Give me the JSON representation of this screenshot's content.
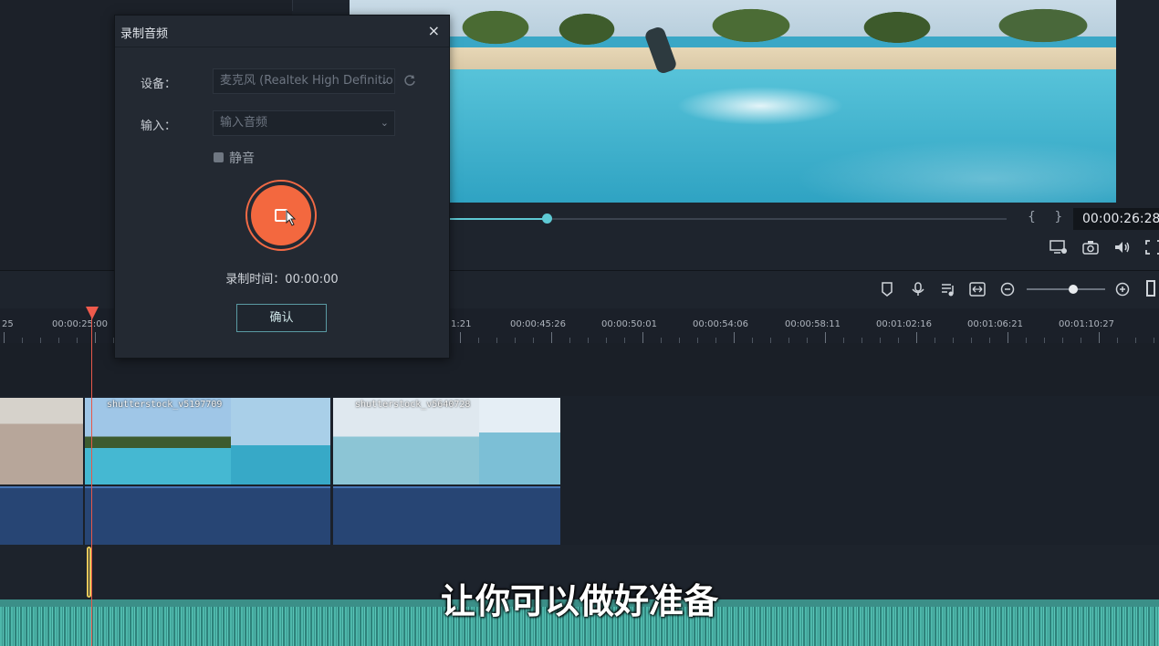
{
  "dialog": {
    "title": "录制音频",
    "close": "×",
    "device_label": "设备：",
    "device_value": "麦克风 (Realtek High Definition",
    "input_label": "输入：",
    "input_placeholder": "输入音频",
    "mute_label": "静音",
    "record_time_label": "录制时间：00:00:00",
    "confirm_button": "确认"
  },
  "preview": {
    "timecode": "00:00:26:28",
    "brackets": "{ }",
    "progress": 0.3
  },
  "ruler": {
    "labels": [
      "25",
      "00:00:25:00",
      "1:21",
      "00:00:45:26",
      "00:00:50:01",
      "00:00:54:06",
      "00:00:58:11",
      "00:01:02:16",
      "00:01:06:21",
      "00:01:10:27"
    ]
  },
  "clips": [
    {
      "name": ""
    },
    {
      "name": "shutterstock_v5197709"
    },
    {
      "name": "shutterstock_v5640728"
    }
  ],
  "subtitle": "让你可以做好准备",
  "icons": {
    "preview_tools": [
      "render-preview-icon",
      "snapshot-icon",
      "volume-icon",
      "fullscreen-icon"
    ],
    "toolbar": [
      "marker-icon",
      "microphone-icon",
      "audio-mix-icon",
      "fit-icon",
      "zoom-out-icon",
      "zoom-in-icon"
    ]
  },
  "colors": {
    "accent": "#5ec9d4",
    "record": "#f3683f",
    "playhead": "#ef5a4c",
    "audio_clip": "#274574",
    "waveform": "#2a6f6c"
  }
}
